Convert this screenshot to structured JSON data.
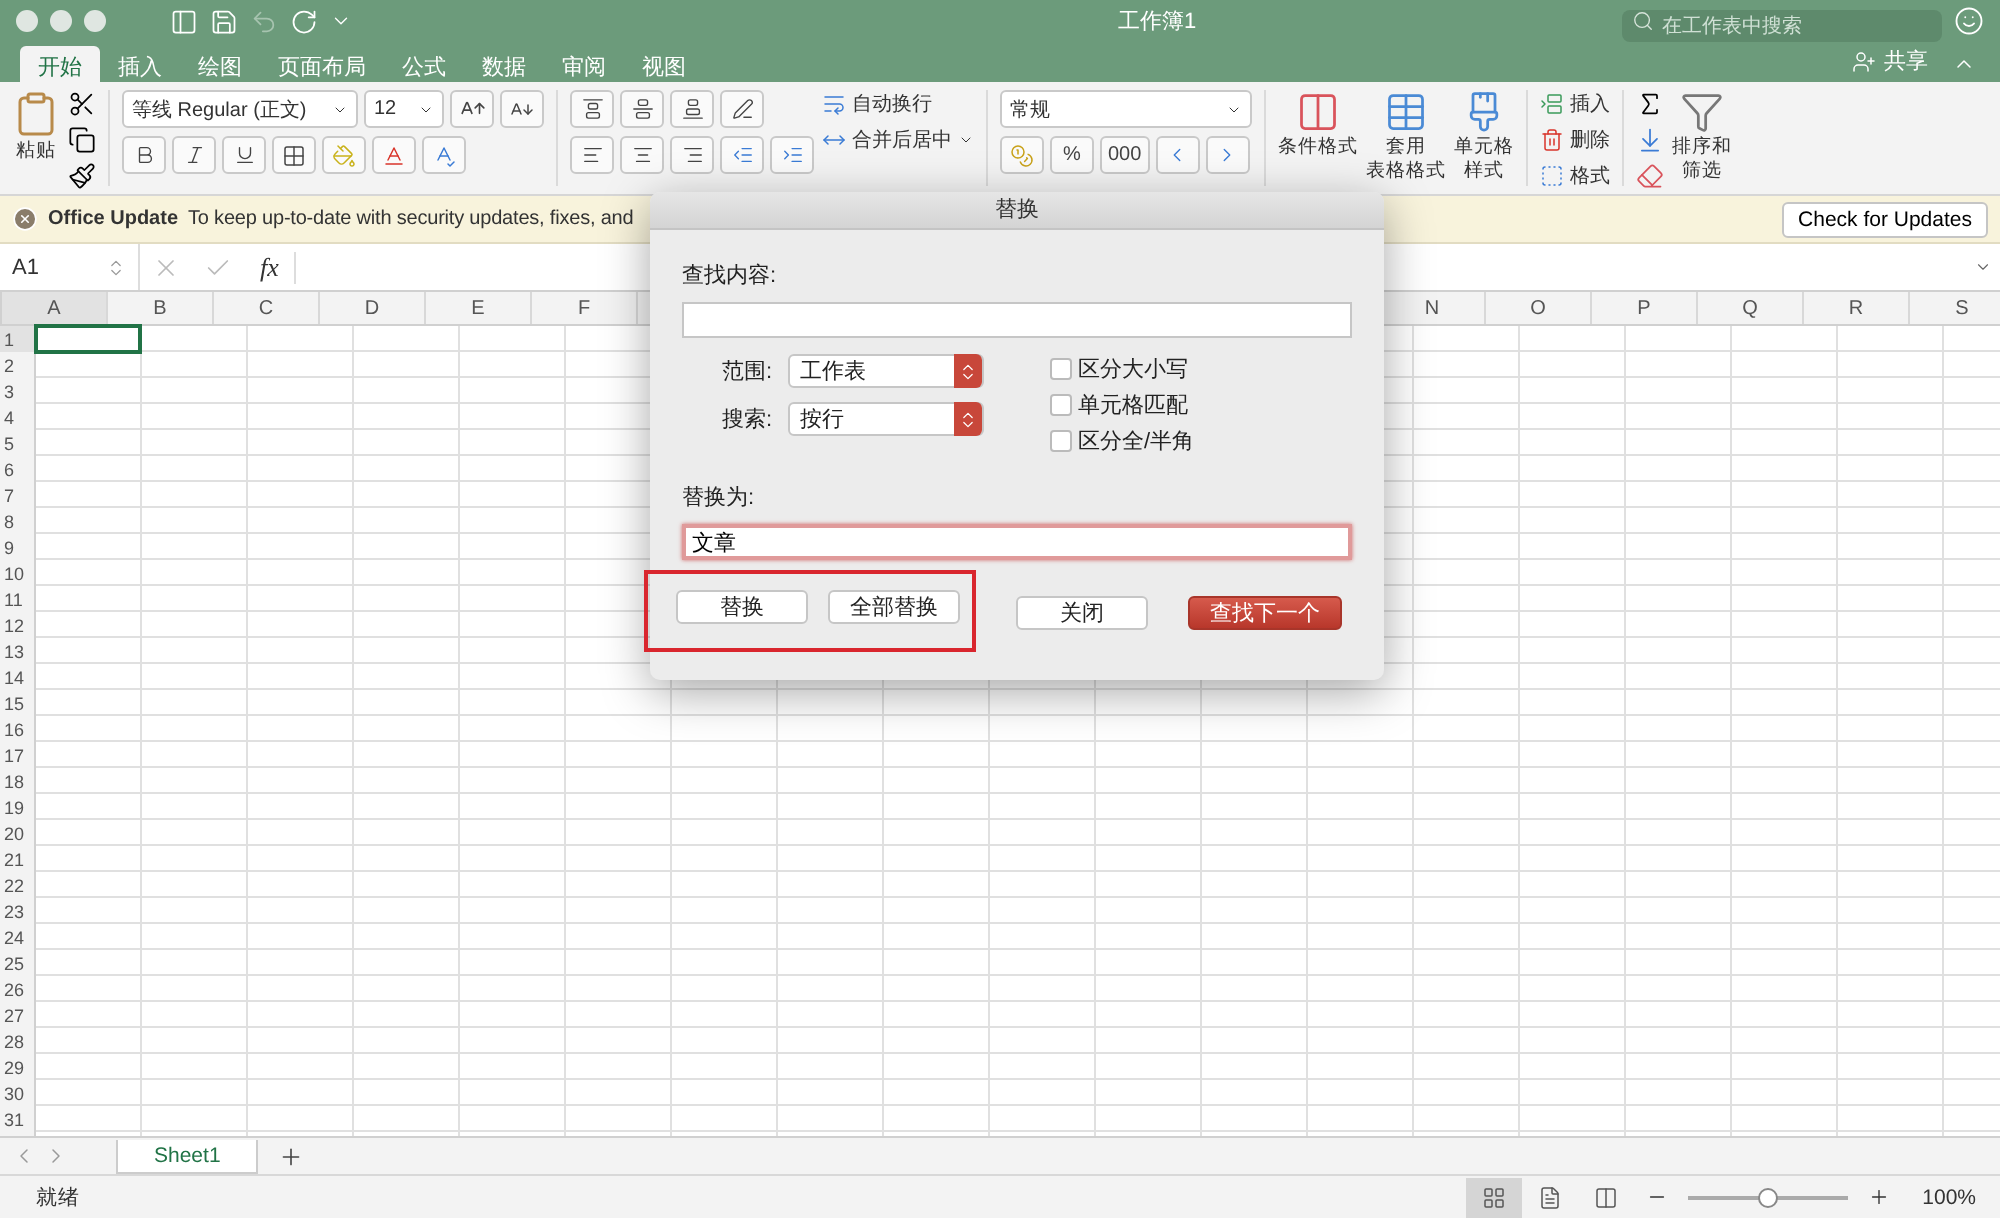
{
  "window": {
    "title": "工作簿1",
    "search_placeholder": "在工作表中搜索",
    "share": "共享"
  },
  "tabs": [
    {
      "label": "开始",
      "selected": true
    },
    {
      "label": "插入",
      "selected": false
    },
    {
      "label": "绘图",
      "selected": false
    },
    {
      "label": "页面布局",
      "selected": false
    },
    {
      "label": "公式",
      "selected": false
    },
    {
      "label": "数据",
      "selected": false
    },
    {
      "label": "审阅",
      "selected": false
    },
    {
      "label": "视图",
      "selected": false
    }
  ],
  "ribbon": {
    "paste": "粘贴",
    "font_name": "等线 Regular (正文)",
    "font_size": "12",
    "wrap_text": "自动换行",
    "merge_center": "合并后居中",
    "number_format": "常规",
    "percent": "%",
    "thousands": "000",
    "conditional_format": [
      "条件格式"
    ],
    "table_format": [
      "套用",
      "表格格式"
    ],
    "cell_styles": [
      "单元格",
      "样式"
    ],
    "insert": "插入",
    "delete": "删除",
    "format": "格式",
    "sort_filter": [
      "排序和",
      "筛选"
    ]
  },
  "update_bar": {
    "title": "Office Update",
    "message": "To keep up-to-date with security updates, fixes, and",
    "button": "Check for Updates"
  },
  "formula_bar": {
    "name_box": "A1",
    "fx": "fx"
  },
  "grid": {
    "columns_left": [
      {
        "label": "A",
        "selected": true
      },
      {
        "label": "B",
        "selected": false
      },
      {
        "label": "C",
        "selected": false
      },
      {
        "label": "D",
        "selected": false
      },
      {
        "label": "E",
        "selected": false
      },
      {
        "label": "F",
        "selected": false
      }
    ],
    "columns_right": [
      "N",
      "O",
      "P",
      "Q",
      "R",
      "S"
    ],
    "rows": [
      {
        "label": "1",
        "selected": true
      },
      {
        "label": "2",
        "selected": false
      },
      {
        "label": "3",
        "selected": false
      },
      {
        "label": "4",
        "selected": false
      },
      {
        "label": "5",
        "selected": false
      },
      {
        "label": "6",
        "selected": false
      },
      {
        "label": "7",
        "selected": false
      },
      {
        "label": "8",
        "selected": false
      },
      {
        "label": "9",
        "selected": false
      },
      {
        "label": "10",
        "selected": false
      },
      {
        "label": "11",
        "selected": false
      },
      {
        "label": "12",
        "selected": false
      },
      {
        "label": "13",
        "selected": false
      },
      {
        "label": "14",
        "selected": false
      },
      {
        "label": "15",
        "selected": false
      },
      {
        "label": "16",
        "selected": false
      },
      {
        "label": "17",
        "selected": false
      },
      {
        "label": "18",
        "selected": false
      },
      {
        "label": "19",
        "selected": false
      },
      {
        "label": "20",
        "selected": false
      },
      {
        "label": "21",
        "selected": false
      },
      {
        "label": "22",
        "selected": false
      },
      {
        "label": "23",
        "selected": false
      },
      {
        "label": "24",
        "selected": false
      },
      {
        "label": "25",
        "selected": false
      },
      {
        "label": "26",
        "selected": false
      },
      {
        "label": "27",
        "selected": false
      },
      {
        "label": "28",
        "selected": false
      },
      {
        "label": "29",
        "selected": false
      },
      {
        "label": "30",
        "selected": false
      },
      {
        "label": "31",
        "selected": false
      }
    ]
  },
  "sheet_tabs": [
    {
      "label": "Sheet1",
      "selected": true
    }
  ],
  "status_bar": {
    "status": "就绪",
    "zoom_slider": {
      "level": 0.5
    },
    "zoom": "100%"
  },
  "dialog": {
    "title": "替换",
    "find_label": "查找内容:",
    "scope_label": "范围:",
    "scope_value": "工作表",
    "search_label": "搜索:",
    "search_value": "按行",
    "options": [
      {
        "label": "区分大小写",
        "checked": false
      },
      {
        "label": "单元格匹配",
        "checked": false
      },
      {
        "label": "区分全/半角",
        "checked": false
      }
    ],
    "replace_label": "替换为:",
    "replace_value": "文章",
    "buttons": [
      {
        "label": "替换",
        "kind": "plain",
        "highlighted": true
      },
      {
        "label": "全部替换",
        "kind": "plain",
        "highlighted": true
      },
      {
        "label": "关闭",
        "kind": "plain",
        "highlighted": false
      },
      {
        "label": "查找下一个",
        "kind": "primary",
        "highlighted": false
      }
    ]
  }
}
